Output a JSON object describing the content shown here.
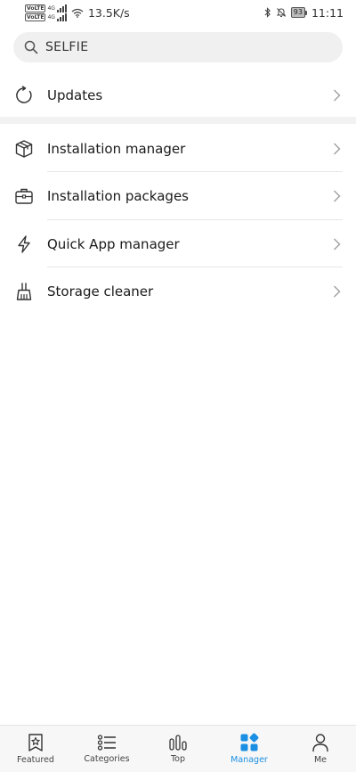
{
  "status_bar": {
    "sim1_badge": "VoLTE",
    "sim1_net": "4G",
    "sim2_badge": "VoLTE",
    "sim2_net": "4G",
    "net_speed": "13.5K/s",
    "battery": "93",
    "time": "11:11"
  },
  "search": {
    "value": "SELFIE"
  },
  "updates": {
    "label": "Updates"
  },
  "menu": [
    {
      "label": "Installation manager",
      "icon": "box-icon"
    },
    {
      "label": "Installation packages",
      "icon": "briefcase-icon"
    },
    {
      "label": "Quick App manager",
      "icon": "lightning-icon"
    },
    {
      "label": "Storage cleaner",
      "icon": "broom-icon"
    }
  ],
  "bottom_nav": [
    {
      "label": "Featured",
      "icon": "bookmark-star-icon",
      "active": false
    },
    {
      "label": "Categories",
      "icon": "list-icon",
      "active": false
    },
    {
      "label": "Top",
      "icon": "bar-chart-icon",
      "active": false
    },
    {
      "label": "Manager",
      "icon": "grid-icon",
      "active": true
    },
    {
      "label": "Me",
      "icon": "person-icon",
      "active": false
    }
  ],
  "colors": {
    "accent": "#1a8fe3",
    "icon": "#333333",
    "chevron": "#9e9e9e"
  }
}
